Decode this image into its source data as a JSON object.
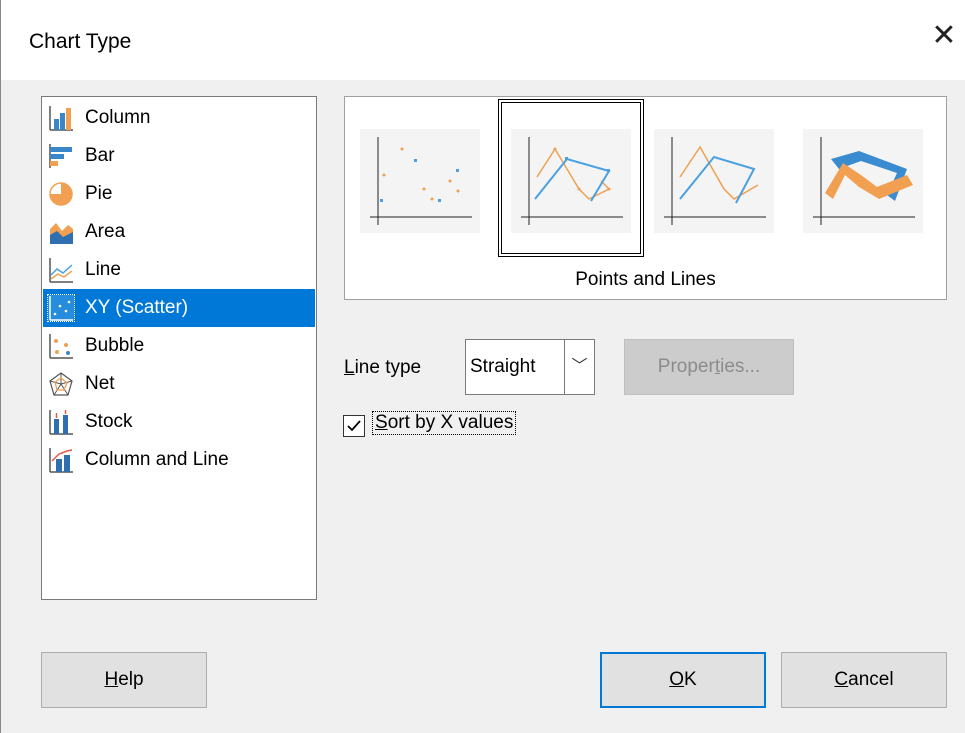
{
  "dialog": {
    "title": "Chart Type",
    "close_icon": "close-icon"
  },
  "chart_types": [
    {
      "label": "Column",
      "icon": "column-chart-icon"
    },
    {
      "label": "Bar",
      "icon": "bar-chart-icon"
    },
    {
      "label": "Pie",
      "icon": "pie-chart-icon"
    },
    {
      "label": "Area",
      "icon": "area-chart-icon"
    },
    {
      "label": "Line",
      "icon": "line-chart-icon"
    },
    {
      "label": "XY (Scatter)",
      "icon": "scatter-chart-icon",
      "selected": true
    },
    {
      "label": "Bubble",
      "icon": "bubble-chart-icon"
    },
    {
      "label": "Net",
      "icon": "net-chart-icon"
    },
    {
      "label": "Stock",
      "icon": "stock-chart-icon"
    },
    {
      "label": "Column and Line",
      "icon": "column-line-chart-icon"
    }
  ],
  "variants": {
    "items": [
      "points-only",
      "points-and-lines",
      "lines-only",
      "3d-lines"
    ],
    "selected_label": "Points and Lines"
  },
  "options": {
    "line_type_label": "Line type",
    "line_type_value": "Straight",
    "properties_label": "Properties...",
    "sort_label": "Sort by X values",
    "sort_checked": true
  },
  "buttons": {
    "help": "Help",
    "ok": "OK",
    "cancel": "Cancel"
  },
  "colors": {
    "selection": "#0078d7",
    "orange": "#f0a050",
    "blue": "#4aa0e0"
  }
}
